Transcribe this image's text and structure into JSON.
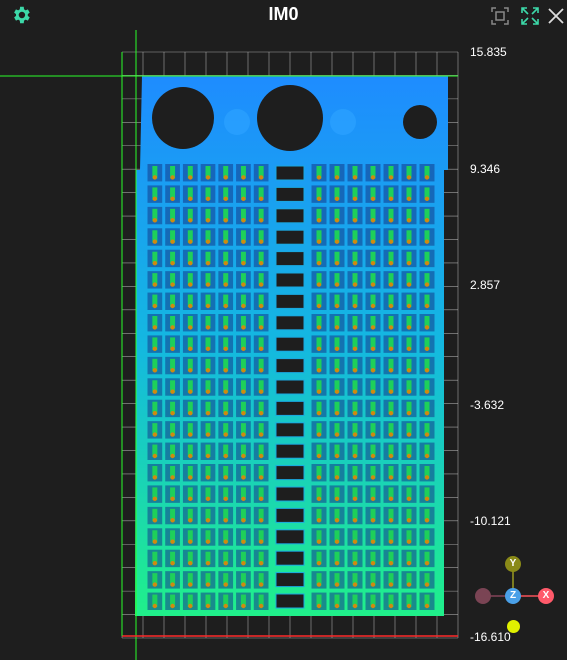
{
  "window": {
    "title": "IM0"
  },
  "toolbar": {
    "settings_icon": "gear-icon",
    "fit_icon": "fit-view-icon",
    "expand_icon": "expand-icon",
    "close_icon": "close-icon"
  },
  "scale": {
    "ticks": [
      "15.835",
      "9.346",
      "2.857",
      "-3.632",
      "-10.121",
      "-16.610"
    ]
  },
  "gizmo": {
    "y_label": "Y",
    "z_label": "Z",
    "x_label": "X"
  },
  "colors": {
    "accent": "#3cd8a8",
    "grid": "#ffffff",
    "axis_x": "#ff2a2a",
    "axis_y": "#2aff2a",
    "board_top": "#1e8cff",
    "board_bottom": "#20f08a"
  }
}
